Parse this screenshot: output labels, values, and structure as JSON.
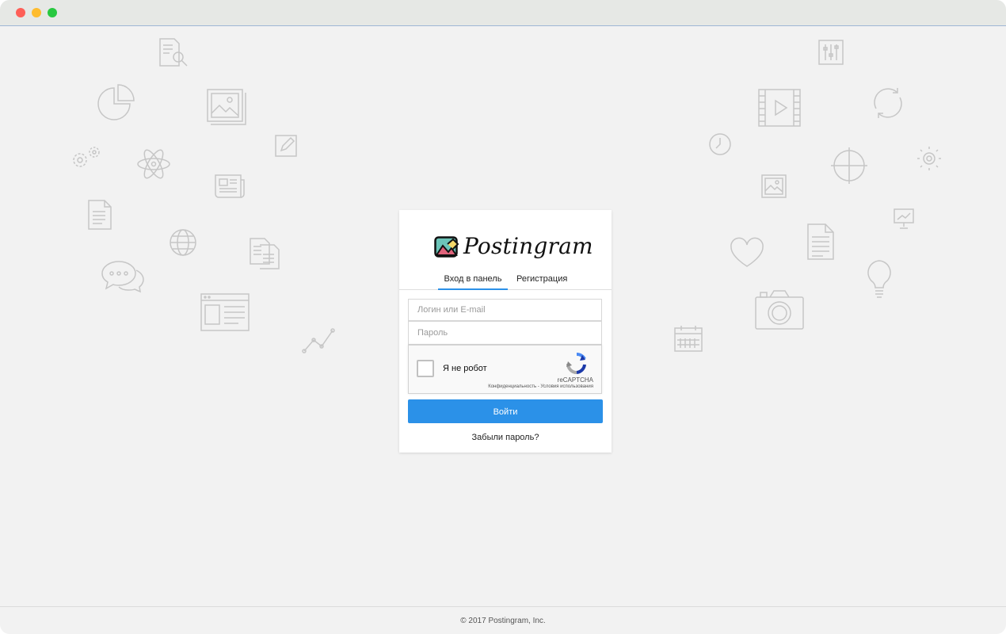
{
  "window": {
    "controls": [
      "close",
      "minimize",
      "maximize"
    ]
  },
  "background_icons": [
    "document-search-icon",
    "pie-chart-icon",
    "image-gallery-icon",
    "edit-icon",
    "gears-icon",
    "atom-icon",
    "newspaper-icon",
    "document-icon",
    "globe-icon",
    "documents-icon",
    "chat-icon",
    "browser-window-icon",
    "line-graph-icon",
    "equalizer-icon",
    "video-icon",
    "refresh-icon",
    "clock-icon",
    "crosshair-icon",
    "sun-icon",
    "picture-icon",
    "presentation-icon",
    "heart-icon",
    "text-document-icon",
    "lightbulb-icon",
    "camera-icon",
    "calendar-icon"
  ],
  "brand": {
    "name": "Postingram",
    "logo_icon": "image-logo-icon"
  },
  "tabs": {
    "login": "Вход в панель",
    "register": "Регистрация",
    "active": "login"
  },
  "form": {
    "login_placeholder": "Логин или E-mail",
    "login_value": "",
    "password_placeholder": "Пароль",
    "password_value": ""
  },
  "recaptcha": {
    "label": "Я не робот",
    "brand": "reCAPTCHA",
    "links": "Конфиденциальность - Условия использования",
    "checked": false
  },
  "actions": {
    "submit_label": "Войти",
    "forgot_label": "Забыли пароль?"
  },
  "footer": {
    "copyright": "© 2017 Postingram, Inc."
  },
  "colors": {
    "accent": "#2b91e8",
    "background": "#f2f2f2"
  }
}
